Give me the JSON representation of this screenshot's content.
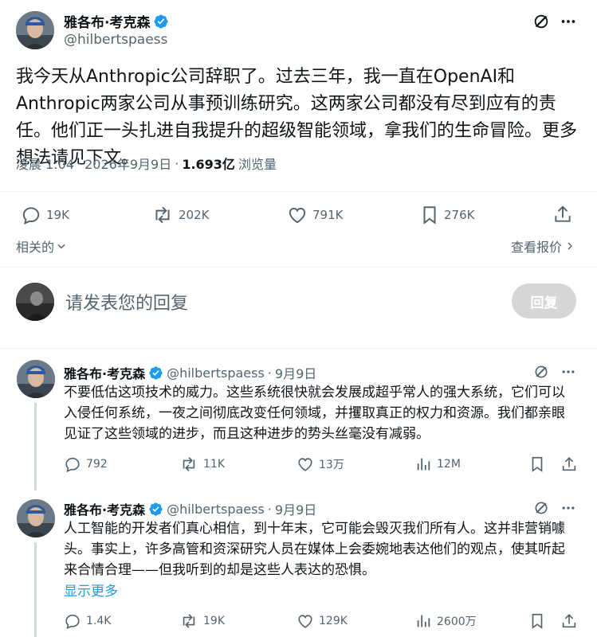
{
  "main_tweet": {
    "author_name": "雅各布·考克森",
    "handle": "@hilbertspaess",
    "text": "我今天从Anthropic公司辞职了。过去三年，我一直在OpenAI和Anthropic两家公司从事预训练研究。这两家公司都没有尽到应有的责任。他们正一头扎进自我提升的超级智能领域，拿我们的生命冒险。更多想法请见下文。",
    "time": "凌晨 1:04",
    "date": "2026年9月9日",
    "separator": "·",
    "views_count": "1.693亿",
    "views_label": "浏览量",
    "replies": "19K",
    "reposts": "202K",
    "likes": "791K",
    "bookmarks": "276K",
    "related_label": "相关的",
    "quotes_label": "查看报价"
  },
  "reply_box": {
    "placeholder": "请发表您的回复",
    "button_label": "回复"
  },
  "thread": [
    {
      "author_name": "雅各布·考克森",
      "handle": "@hilbertspaess",
      "dot": "·",
      "date": "9月9日",
      "text": "不要低估这项技术的威力。这些系统很快就会发展成超乎常人的强大系统，它们可以入侵任何系统，一夜之间彻底改变任何领域，并攫取真正的权力和资源。我们都亲眼见证了这些领域的进步，而且这种进步的势头丝毫没有减弱。",
      "replies": "792",
      "reposts": "11K",
      "likes": "13万",
      "views": "12M"
    },
    {
      "author_name": "雅各布·考克森",
      "handle": "@hilbertspaess",
      "dot": "·",
      "date": "9月9日",
      "text": "人工智能的开发者们真心相信，到十年末，它可能会毁灭我们所有人。这并非营销噱头。事实上，许多高管和资深研究人员在媒体上会委婉地表达他们的观点，使其听起来合情合理——但我听到的却是这些人表达的恐惧。",
      "show_more": "显示更多",
      "replies": "1.4K",
      "reposts": "19K",
      "likes": "129K",
      "views": "2600万"
    }
  ],
  "colors": {
    "text": "#0f1419",
    "secondary": "#536471",
    "verified": "#1d9bf0",
    "link": "#1d9bf0",
    "divider": "#eff3f4",
    "reply_button_disabled": "#d4d6d8"
  },
  "icons": [
    "verified-badge-icon",
    "grok-icon",
    "more-icon",
    "reply-icon",
    "repost-icon",
    "like-icon",
    "bookmark-icon",
    "share-icon",
    "views-icon",
    "chevron-down-icon",
    "chevron-right-icon"
  ]
}
